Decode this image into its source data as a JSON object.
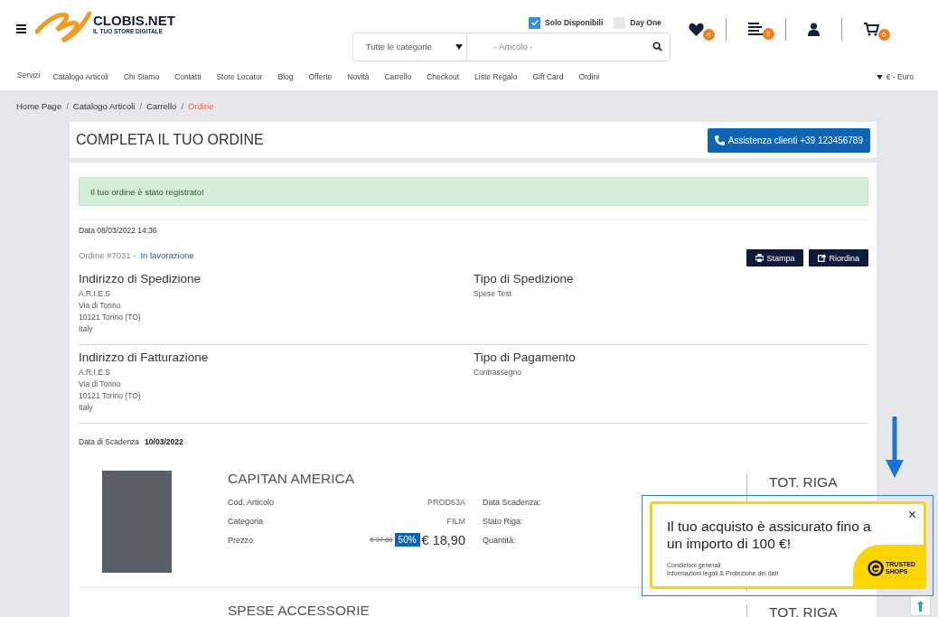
{
  "header": {
    "logo": {
      "name": "CLOBIS.NET",
      "tagline": "IL TUO STORE DIGITALE"
    },
    "filters": [
      {
        "label": "Solo Disponibili",
        "checked": true
      },
      {
        "label": "Day One",
        "checked": false
      }
    ],
    "search": {
      "category": "Tutte le categorie",
      "placeholder": "- Articolo -"
    },
    "icons": [
      {
        "kind": "wishlist",
        "count": "4"
      },
      {
        "kind": "list",
        "count": "2"
      },
      {
        "kind": "user"
      },
      {
        "kind": "cart",
        "count": "0"
      }
    ]
  },
  "nav": {
    "items": [
      "Servizi",
      "Catalogo Articoli",
      "Chi Siamo",
      "Contatti",
      "Store Locator",
      "Blog",
      "Offerte",
      "Novità",
      "Carrello",
      "Checkout",
      "Liste Regalo",
      "Gift Card",
      "Ordini"
    ],
    "currency": "€ - Euro"
  },
  "breadcrumb_separator": "/",
  "breadcrumb": [
    {
      "label": "Home Page",
      "selected": false
    },
    {
      "label": "Catalogo Articoli",
      "selected": false
    },
    {
      "label": "Carrello",
      "selected": false
    },
    {
      "label": "Ordine",
      "selected": true
    }
  ],
  "page": {
    "title": "COMPLETA IL TUO ORDINE",
    "support_button": "Assistenza clienti +39 123456789"
  },
  "alert": "Il tuo ordine è stato registrato!",
  "order": {
    "date": "Data 08/03/2022 14:36",
    "number": "Ordine #7031 -",
    "status": "In lavorazione",
    "actions": [
      {
        "kind": "print",
        "label": "Stampa"
      },
      {
        "kind": "reorder",
        "label": "Riordina"
      }
    ]
  },
  "sections": [
    [
      {
        "heading": "Indirizzo di Spedizione",
        "lines": [
          "A.R.I.E.S",
          "Via di Torino",
          "10121 Torino (TO)",
          "Italy"
        ]
      },
      {
        "heading": "Tipo di Spedizione",
        "lines": [
          "Spese Test"
        ]
      }
    ],
    [
      {
        "heading": "Indirizzo di Fatturazione",
        "lines": [
          "A.R.I.E.S",
          "Via di Torino",
          "10121 Torino (TO)",
          "Italy"
        ]
      },
      {
        "heading": "Tipo di Pagamento",
        "lines": [
          "Contrassegno"
        ]
      }
    ]
  ],
  "due_date": {
    "label": "Data di Scadenza",
    "value": "10/03/2022"
  },
  "product": {
    "name": "CAPITAN AMERICA",
    "details": [
      {
        "label": "Cod. Articolo",
        "value": "PROD63A"
      },
      {
        "label": "Categoria",
        "value": "FILM"
      }
    ],
    "price_label": "Prezzo",
    "old_price": "€ 37,80",
    "discount": "50%",
    "price": "€ 18,90",
    "side_labels": [
      "Data Scadenza:",
      "Stato Riga:",
      "Quantità:"
    ],
    "total_heading": "TOT. RIGA"
  },
  "extra": {
    "name": "SPESE ACCESSORIE",
    "total_heading": "TOT. RIGA"
  },
  "popup": {
    "message": "Il tuo acquisto è assicurato fino a un importo di 100 €!",
    "links": [
      "Condizioni generali",
      "Informazioni legali & Protezione dei dati"
    ],
    "badge": "TRUSTED SHOPS",
    "close": "×"
  }
}
